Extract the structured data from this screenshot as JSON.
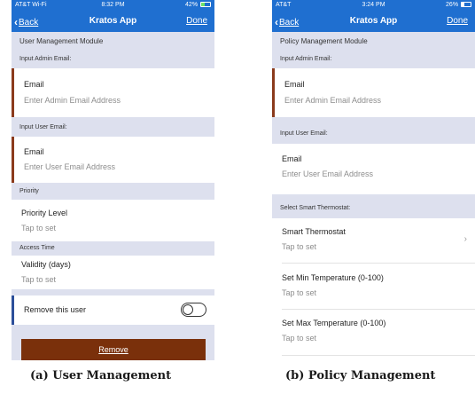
{
  "phone_a": {
    "status": {
      "carrier": "AT&T Wi-Fi",
      "time": "8:32 PM",
      "battery": "42%",
      "battery_level": 0.42
    },
    "nav": {
      "back": "Back",
      "title": "Kratos App",
      "done": "Done"
    },
    "module_header": "User Management Module",
    "admin_header": "Input Admin Email:",
    "admin_field": {
      "label": "Email",
      "placeholder": "Enter Admin Email Address"
    },
    "user_header": "Input User Email:",
    "user_field": {
      "label": "Email",
      "placeholder": "Enter User Email Address"
    },
    "priority_header": "Priority",
    "priority_field": {
      "label": "Priority Level",
      "value": "Tap to set"
    },
    "access_header": "Access Time",
    "validity_field": {
      "label": "Validity (days)",
      "value": "Tap to set"
    },
    "remove_toggle": {
      "label": "Remove this user",
      "on": false
    },
    "remove_button": "Remove"
  },
  "phone_b": {
    "status": {
      "carrier": "AT&T",
      "time": "3:24 PM",
      "battery": "26%",
      "battery_level": 0.26
    },
    "nav": {
      "back": "Back",
      "title": "Kratos App",
      "done": "Done"
    },
    "module_header": "Policy Management Module",
    "admin_header": "Input Admin Email:",
    "admin_field": {
      "label": "Email",
      "placeholder": "Enter Admin Email Address"
    },
    "user_header": "Input User Email:",
    "user_field": {
      "label": "Email",
      "placeholder": "Enter User Email Address"
    },
    "thermostat_header": "Select Smart Thermostat:",
    "thermostat_field": {
      "label": "Smart Thermostat",
      "value": "Tap to set"
    },
    "min_temp_field": {
      "label": "Set Min Temperature (0-100)",
      "value": "Tap to set"
    },
    "max_temp_field": {
      "label": "Set Max Temperature (0-100)",
      "value": "Tap to set"
    }
  },
  "captions": {
    "a": "(a) User Management",
    "b": "(b) Policy Management"
  },
  "colors": {
    "nav_blue": "#1f6fd0",
    "section_header": "#dde0ee",
    "accent_red": "#8b3a1c",
    "accent_blue": "#2c4f9a",
    "remove_button": "#7a300b"
  }
}
